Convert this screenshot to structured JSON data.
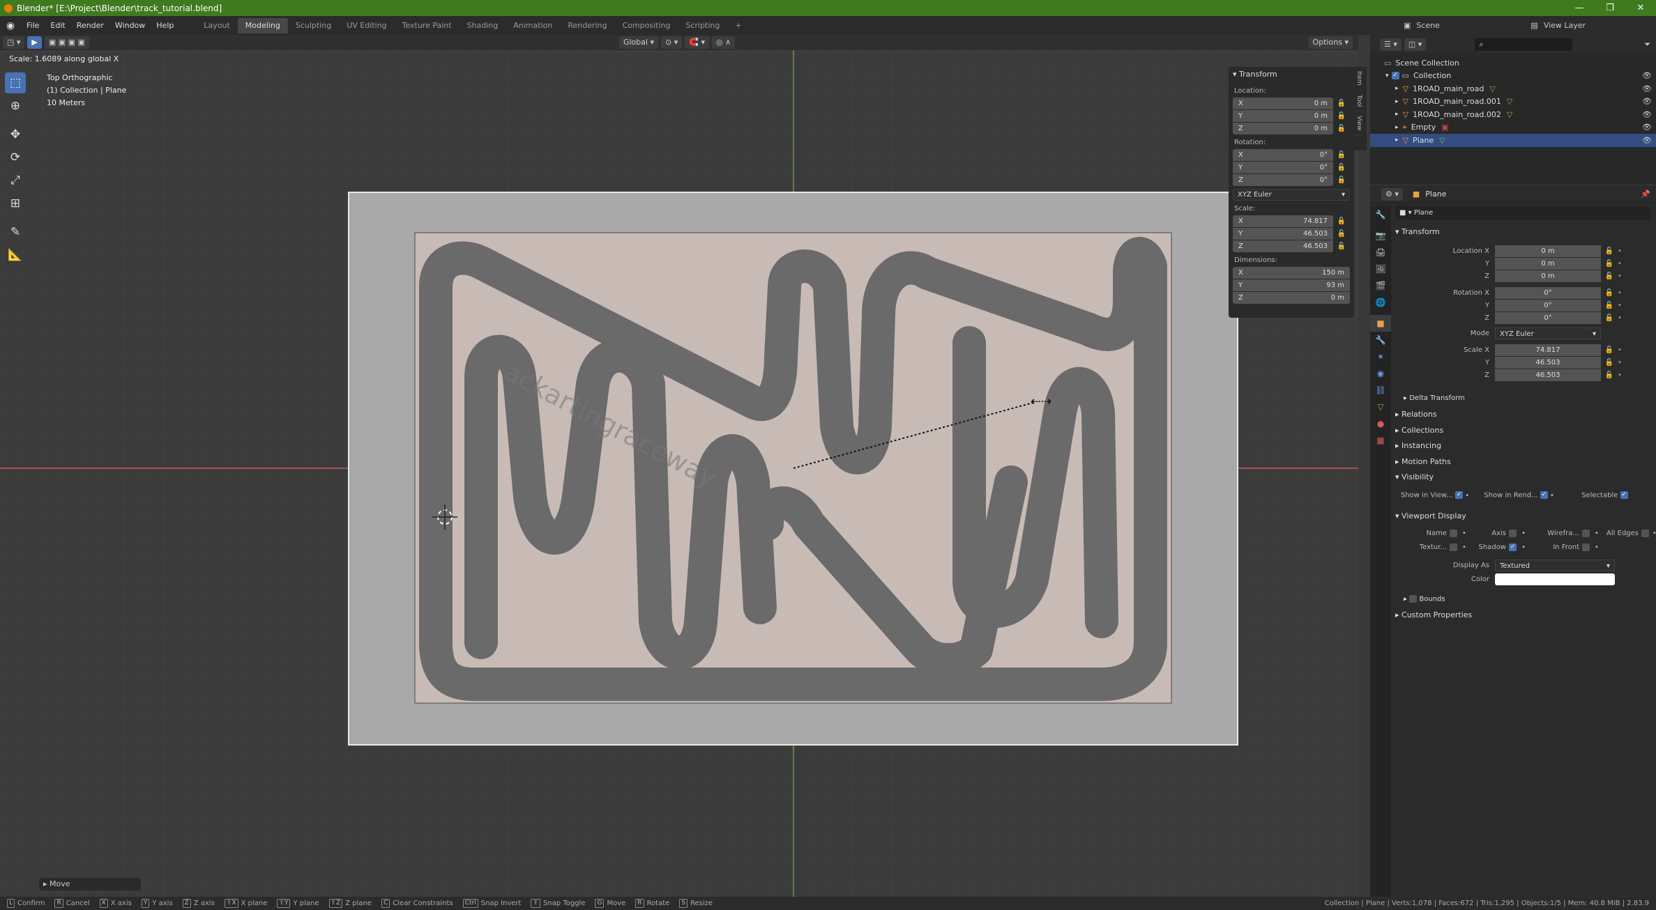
{
  "window": {
    "title": "Blender* [E:\\Project\\Blender\\track_tutorial.blend]",
    "min": "—",
    "max": "❐",
    "close": "✕"
  },
  "menu": [
    "File",
    "Edit",
    "Render",
    "Window",
    "Help"
  ],
  "workspaces": [
    "Layout",
    "Modeling",
    "Sculpting",
    "UV Editing",
    "Texture Paint",
    "Shading",
    "Animation",
    "Rendering",
    "Compositing",
    "Scripting",
    "+"
  ],
  "active_workspace": "Modeling",
  "scene": {
    "name": "Scene",
    "view_layer": "View Layer"
  },
  "viewport": {
    "header": {
      "orientation": "Global",
      "options": "Options"
    },
    "operator_text": "Scale: 1.6089 along global X",
    "view_name": "Top Orthographic",
    "collection": "(1) Collection | Plane",
    "scale_label": "10 Meters",
    "move_panel": "Move",
    "watermark_text": "ackartingraceway"
  },
  "npanel": {
    "title": "Transform",
    "location_label": "Location:",
    "location": [
      {
        "axis": "X",
        "value": "0 m"
      },
      {
        "axis": "Y",
        "value": "0 m"
      },
      {
        "axis": "Z",
        "value": "0 m"
      }
    ],
    "rotation_label": "Rotation:",
    "rotation": [
      {
        "axis": "X",
        "value": "0°"
      },
      {
        "axis": "Y",
        "value": "0°"
      },
      {
        "axis": "Z",
        "value": "0°"
      }
    ],
    "rotation_mode": "XYZ Euler",
    "scale_label": "Scale:",
    "scale": [
      {
        "axis": "X",
        "value": "74.817"
      },
      {
        "axis": "Y",
        "value": "46.503"
      },
      {
        "axis": "Z",
        "value": "46.503"
      }
    ],
    "dimensions_label": "Dimensions:",
    "dimensions": [
      {
        "axis": "X",
        "value": "150 m"
      },
      {
        "axis": "Y",
        "value": "93 m"
      },
      {
        "axis": "Z",
        "value": "0 m"
      }
    ],
    "tabs": [
      "Item",
      "Tool",
      "View"
    ]
  },
  "outliner": {
    "root": "Scene Collection",
    "collection": "Collection",
    "items": [
      "1ROAD_main_road",
      "1ROAD_main_road.001",
      "1ROAD_main_road.002",
      "Empty",
      "Plane"
    ]
  },
  "properties": {
    "object_name": "Plane",
    "object_field": "Plane",
    "transform": "Transform",
    "location": [
      {
        "label": "Location X",
        "value": "0 m"
      },
      {
        "label": "Y",
        "value": "0 m"
      },
      {
        "label": "Z",
        "value": "0 m"
      }
    ],
    "rotation": [
      {
        "label": "Rotation X",
        "value": "0°"
      },
      {
        "label": "Y",
        "value": "0°"
      },
      {
        "label": "Z",
        "value": "0°"
      }
    ],
    "mode_label": "Mode",
    "mode_value": "XYZ Euler",
    "scale": [
      {
        "label": "Scale X",
        "value": "74.817"
      },
      {
        "label": "Y",
        "value": "46.503"
      },
      {
        "label": "Z",
        "value": "46.503"
      }
    ],
    "sections": [
      "Delta Transform",
      "Relations",
      "Collections",
      "Instancing",
      "Motion Paths",
      "Visibility"
    ],
    "visibility": {
      "show_in_viewport": "Show in View...",
      "show_in_render": "Show in Rend...",
      "selectable": "Selectable"
    },
    "viewport_display": "Viewport Display",
    "vd_row1": [
      "Name",
      "Axis",
      "Wirefra...",
      "All Edges"
    ],
    "vd_row2": [
      "Textur...",
      "Shadow",
      "In Front"
    ],
    "display_as_label": "Display As",
    "display_as": "Textured",
    "color_label": "Color",
    "bounds": "Bounds",
    "custom_props": "Custom Properties"
  },
  "statusbar": {
    "left": [
      {
        "key": "L",
        "label": "Confirm"
      },
      {
        "key": "R",
        "label": "Cancel"
      },
      {
        "key": "X",
        "label": "X axis"
      },
      {
        "key": "Y",
        "label": "Y axis"
      },
      {
        "key": "Z",
        "label": "Z axis"
      },
      {
        "key": "⇧X",
        "label": "X plane"
      },
      {
        "key": "⇧Y",
        "label": "Y plane"
      },
      {
        "key": "⇧Z",
        "label": "Z plane"
      },
      {
        "key": "C",
        "label": "Clear Constraints"
      },
      {
        "key": "Ctrl",
        "label": "Snap Invert"
      },
      {
        "key": "⇧",
        "label": "Snap Toggle"
      },
      {
        "key": "G",
        "label": "Move"
      },
      {
        "key": "R",
        "label": "Rotate"
      },
      {
        "key": "S",
        "label": "Resize"
      }
    ],
    "right": "Collection | Plane | Verts:1,078 | Faces:672 | Tris:1,295 | Objects:1/5 | Mem: 40.8 MiB | 2.83.9"
  },
  "colors": {
    "accent": "#4772b3",
    "titlebar": "#3f7a1f",
    "x_axis": "#c85a5a",
    "y_axis": "#6f9a3a"
  }
}
